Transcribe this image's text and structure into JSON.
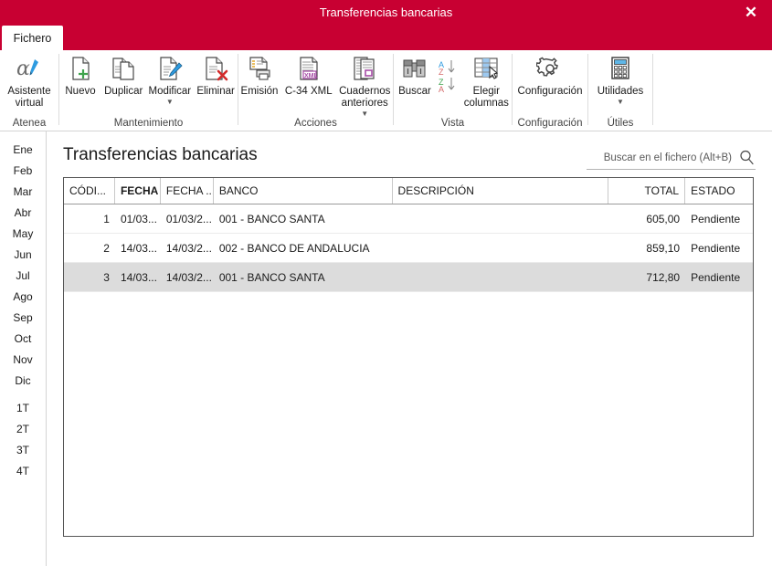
{
  "window": {
    "title": "Transferencias bancarias",
    "close_label": "✕",
    "close_icon": "close-icon"
  },
  "tabs": [
    {
      "label": "Fichero",
      "active": true
    }
  ],
  "ribbon": {
    "groups": [
      {
        "label": "Atenea",
        "buttons": [
          {
            "label": "Asistente virtual",
            "icon": "alpha-assistant-icon",
            "has_caret": false
          }
        ]
      },
      {
        "label": "Mantenimiento",
        "buttons": [
          {
            "label": "Nuevo",
            "icon": "new-document-icon",
            "has_caret": false
          },
          {
            "label": "Duplicar",
            "icon": "duplicate-document-icon",
            "has_caret": false
          },
          {
            "label": "Modificar",
            "icon": "edit-document-icon",
            "has_caret": true
          },
          {
            "label": "Eliminar",
            "icon": "delete-document-icon",
            "has_caret": false
          }
        ]
      },
      {
        "label": "Acciones",
        "buttons": [
          {
            "label": "Emisión",
            "icon": "print-document-icon",
            "has_caret": false
          },
          {
            "label": "C-34 XML",
            "icon": "xml-document-icon",
            "has_caret": false
          },
          {
            "label": "Cuadernos anteriores",
            "icon": "previous-notebooks-icon",
            "has_caret": true
          }
        ]
      },
      {
        "label": "Vista",
        "buttons": [
          {
            "label": "Buscar",
            "icon": "binoculars-icon",
            "has_caret": false
          },
          {
            "label": "",
            "icon": "sort-az-za-icon",
            "has_caret": false
          },
          {
            "label": "Elegir columnas",
            "icon": "choose-columns-icon",
            "has_caret": false
          }
        ]
      },
      {
        "label": "Configuración",
        "buttons": [
          {
            "label": "Configuración",
            "icon": "gear-icon",
            "has_caret": false
          }
        ]
      },
      {
        "label": "Útiles",
        "buttons": [
          {
            "label": "Utilidades",
            "icon": "calculator-icon",
            "has_caret": true
          }
        ]
      }
    ]
  },
  "sidebar": {
    "months": [
      "Ene",
      "Feb",
      "Mar",
      "Abr",
      "May",
      "Jun",
      "Jul",
      "Ago",
      "Sep",
      "Oct",
      "Nov",
      "Dic"
    ],
    "quarters": [
      "1T",
      "2T",
      "3T",
      "4T"
    ]
  },
  "main": {
    "page_title": "Transferencias bancarias",
    "search": {
      "value": "",
      "placeholder": "Buscar en el fichero (Alt+B)",
      "icon": "search-icon"
    },
    "grid": {
      "columns": [
        {
          "key": "codigo",
          "label": "CÓDI...",
          "bold": false,
          "align": "left"
        },
        {
          "key": "fecha",
          "label": "FECHA",
          "bold": true,
          "align": "left"
        },
        {
          "key": "fecha2",
          "label": "FECHA ...",
          "bold": false,
          "align": "left"
        },
        {
          "key": "banco",
          "label": "BANCO",
          "bold": false,
          "align": "left"
        },
        {
          "key": "descripcion",
          "label": "DESCRIPCIÓN",
          "bold": false,
          "align": "left"
        },
        {
          "key": "total",
          "label": "TOTAL",
          "bold": false,
          "align": "right"
        },
        {
          "key": "estado",
          "label": "ESTADO",
          "bold": false,
          "align": "left"
        }
      ],
      "rows": [
        {
          "codigo": "1",
          "fecha": "01/03...",
          "fecha2": "01/03/2...",
          "banco": "001 - BANCO SANTA",
          "descripcion": "",
          "total": "605,00",
          "estado": "Pendiente",
          "selected": false
        },
        {
          "codigo": "2",
          "fecha": "14/03...",
          "fecha2": "14/03/2...",
          "banco": "002 - BANCO DE ANDALUCIA",
          "descripcion": "",
          "total": "859,10",
          "estado": "Pendiente",
          "selected": false
        },
        {
          "codigo": "3",
          "fecha": "14/03...",
          "fecha2": "14/03/2...",
          "banco": "001 - BANCO SANTA",
          "descripcion": "",
          "total": "712,80",
          "estado": "Pendiente",
          "selected": true
        }
      ]
    }
  },
  "colors": {
    "brand_red": "#C80032",
    "selected_row": "#DCDCDC",
    "grid_border": "#555555",
    "text": "#1A1A1A"
  }
}
